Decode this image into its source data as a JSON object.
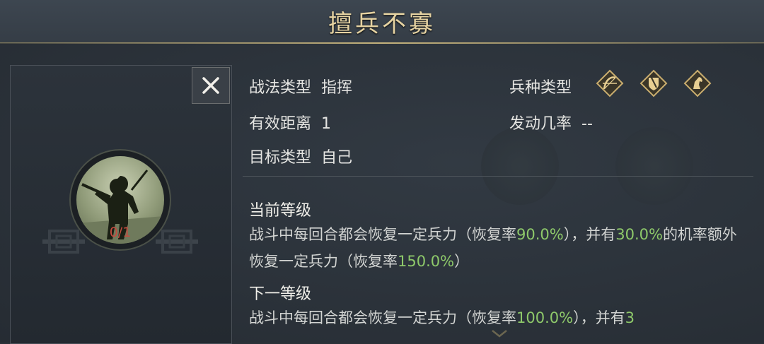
{
  "header": {
    "title": "擅兵不寡"
  },
  "portrait": {
    "count": "0/1"
  },
  "info": {
    "tactic_type_label": "战法类型",
    "tactic_type_value": "指挥",
    "distance_label": "有效距离",
    "distance_value": "1",
    "target_label": "目标类型",
    "target_value": "自己",
    "troop_type_label": "兵种类型",
    "troop_icons": [
      "bow-icon",
      "shield-icon",
      "horse-icon"
    ],
    "trigger_rate_label": "发动几率",
    "trigger_rate_value": "--"
  },
  "current_level": {
    "title": "当前等级",
    "text_1": "战斗中每回合都会恢复一定兵力（恢复率",
    "rate_1": "90.0%",
    "text_2": "），并有",
    "chance": "30.0%",
    "text_3": "的机率额外恢复一定兵力（恢复率",
    "rate_2": "150.0%",
    "text_4": "）"
  },
  "next_level": {
    "title": "下一等级",
    "text_1": "战斗中每回合都会恢复一定兵力（恢复率",
    "rate_1": "100.0%",
    "text_2": "），并有",
    "chance": "3"
  },
  "colors": {
    "title_gold": "#e6d3a2",
    "highlight_green": "#8ec96a",
    "count_red": "#c44a3e"
  }
}
